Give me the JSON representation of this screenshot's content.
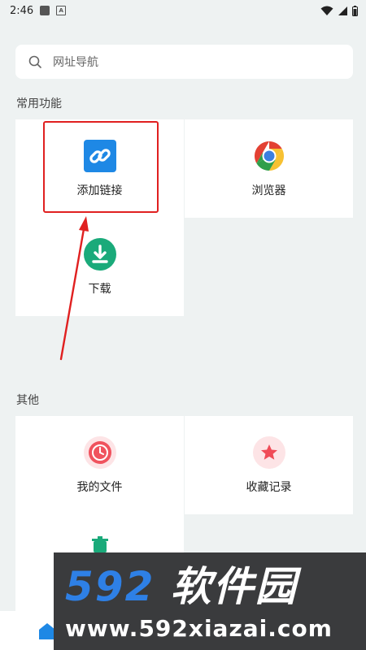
{
  "status_bar": {
    "time": "2:46"
  },
  "search": {
    "placeholder": "网址导航"
  },
  "sections": {
    "common": {
      "title": "常用功能",
      "items": [
        {
          "label": "添加链接",
          "icon": "link-icon"
        },
        {
          "label": "浏览器",
          "icon": "chrome-icon"
        },
        {
          "label": "下载",
          "icon": "download-icon"
        }
      ]
    },
    "other": {
      "title": "其他",
      "items": [
        {
          "label": "我的文件",
          "icon": "clock-icon"
        },
        {
          "label": "收藏记录",
          "icon": "star-icon"
        },
        {
          "label": "",
          "icon": "trash-icon"
        }
      ]
    }
  },
  "watermark": {
    "main_num": "592",
    "main_cn": "软件园",
    "url": "www.592xiazai.com"
  },
  "colors": {
    "link_blue": "#1e88e5",
    "download_green": "#1aaa7a",
    "file_red": "#f0535e",
    "star_red": "#f04b57",
    "highlight_red": "#e02020"
  }
}
